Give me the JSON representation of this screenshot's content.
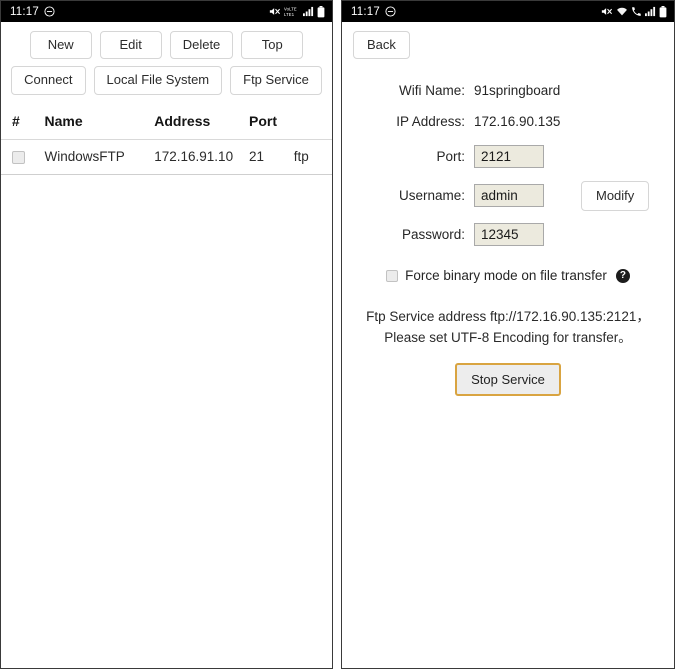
{
  "left_phone": {
    "statusbar": {
      "time": "11:17",
      "dnd_icon": "do-not-disturb-icon",
      "icons": [
        "mute-icon",
        "volte-icon",
        "signal-bars-icon",
        "battery-icon"
      ],
      "volte_label": "VoLTE1"
    },
    "toolbar": {
      "row1": [
        {
          "label": "New",
          "name": "new-button"
        },
        {
          "label": "Edit",
          "name": "edit-button"
        },
        {
          "label": "Delete",
          "name": "delete-button"
        },
        {
          "label": "Top",
          "name": "top-button"
        }
      ],
      "row2": [
        {
          "label": "Connect",
          "name": "connect-button"
        },
        {
          "label": "Local File System",
          "name": "local-file-system-button"
        },
        {
          "label": "Ftp Service",
          "name": "ftp-service-button"
        }
      ]
    },
    "table": {
      "headers": [
        "#",
        "Name",
        "Address",
        "Port",
        ""
      ],
      "rows": [
        {
          "selected": false,
          "name": "WindowsFTP",
          "address": "172.16.91.10",
          "port": "21",
          "protocol": "ftp"
        }
      ]
    }
  },
  "right_phone": {
    "statusbar": {
      "time": "11:17",
      "dnd_icon": "do-not-disturb-icon",
      "icons": [
        "mute-icon",
        "wifi-icon",
        "call-signal-icon",
        "signal-bars-icon",
        "battery-icon"
      ]
    },
    "back_label": "Back",
    "form": {
      "wifi_name_label": "Wifi Name:",
      "wifi_name_value": "91springboard",
      "ip_address_label": "IP Address:",
      "ip_address_value": "172.16.90.135",
      "port_label": "Port:",
      "port_value": "2121",
      "username_label": "Username:",
      "username_value": "admin",
      "password_label": "Password:",
      "password_value": "12345",
      "modify_label": "Modify"
    },
    "force_binary": {
      "checked": false,
      "label": "Force binary mode on file transfer",
      "help_glyph": "?"
    },
    "service_note_line1": "Ftp Service address ftp://172.16.90.135:2121，",
    "service_note_line2": "Please set UTF-8 Encoding for transfer。",
    "stop_service_label": "Stop Service"
  },
  "colors": {
    "statusbar_bg": "#000000",
    "panel_border": "#3a3a3a",
    "button_border": "#d6d6d6",
    "input_bg": "#eceade",
    "input_border": "#a9a9a9",
    "stop_button_border": "#d9a441",
    "stop_button_bg": "#ededed"
  }
}
